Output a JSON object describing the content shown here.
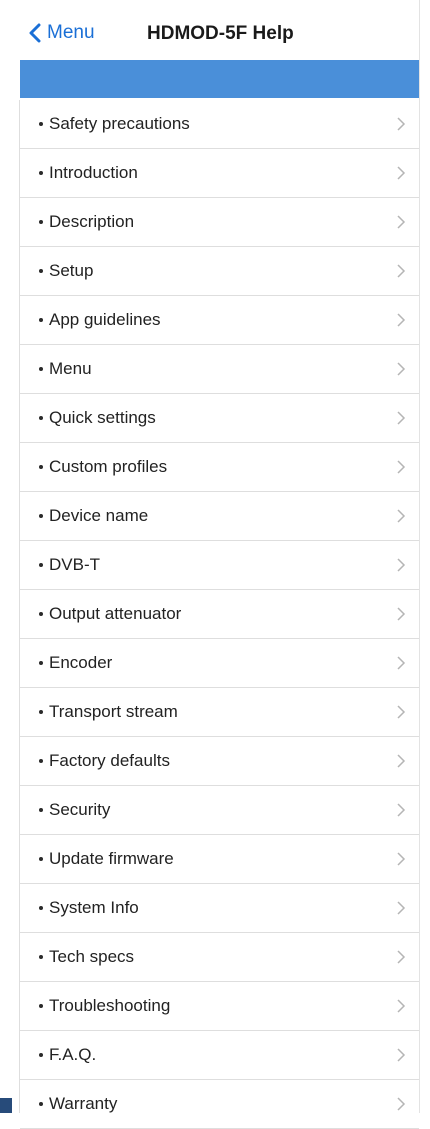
{
  "header": {
    "back_label": "Menu",
    "title": "HDMOD-5F Help"
  },
  "colors": {
    "accent": "#1a6fd6",
    "bar": "#4a8fd9",
    "corner": "#274b7a"
  },
  "items": [
    {
      "label": "Safety precautions"
    },
    {
      "label": "Introduction"
    },
    {
      "label": "Description"
    },
    {
      "label": "Setup"
    },
    {
      "label": "App guidelines"
    },
    {
      "label": "Menu"
    },
    {
      "label": "Quick settings"
    },
    {
      "label": "Custom profiles"
    },
    {
      "label": "Device name"
    },
    {
      "label": "DVB-T"
    },
    {
      "label": "Output attenuator"
    },
    {
      "label": "Encoder"
    },
    {
      "label": "Transport stream"
    },
    {
      "label": "Factory defaults"
    },
    {
      "label": "Security"
    },
    {
      "label": "Update firmware"
    },
    {
      "label": "System Info"
    },
    {
      "label": "Tech specs"
    },
    {
      "label": "Troubleshooting"
    },
    {
      "label": "F.A.Q."
    },
    {
      "label": "Warranty"
    }
  ]
}
